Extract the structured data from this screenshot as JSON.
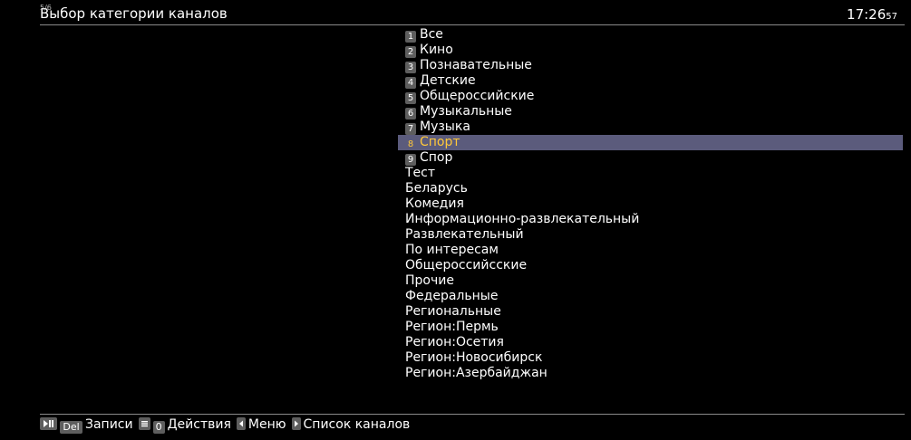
{
  "header": {
    "title": "Выбор категории каналов",
    "badge": "5/6",
    "clock_time": "17:26",
    "clock_seconds": "57"
  },
  "categories": [
    {
      "number": "1",
      "label": "Все"
    },
    {
      "number": "2",
      "label": "Кино"
    },
    {
      "number": "3",
      "label": "Познавательные"
    },
    {
      "number": "4",
      "label": "Детские"
    },
    {
      "number": "5",
      "label": "Общероссийские"
    },
    {
      "number": "6",
      "label": "Музыкальные"
    },
    {
      "number": "7",
      "label": "Музыка"
    },
    {
      "number": "8",
      "label": "Спорт",
      "selected": true
    },
    {
      "number": "9",
      "label": "Спор"
    },
    {
      "label": "Тест"
    },
    {
      "label": "Беларусь"
    },
    {
      "label": "Комедия"
    },
    {
      "label": "Информационно-развлекательный"
    },
    {
      "label": "Развлекательный"
    },
    {
      "label": "По интересам"
    },
    {
      "label": "Общероссийсские"
    },
    {
      "label": "Прочие"
    },
    {
      "label": "Федеральные"
    },
    {
      "label": "Региональные"
    },
    {
      "label": "Регион:Пермь"
    },
    {
      "label": "Регион:Осетия"
    },
    {
      "label": "Регион:Новосибирск"
    },
    {
      "label": "Регион:Азербайджан"
    }
  ],
  "footer": {
    "key_del": "Del",
    "records_label": "Записи",
    "key_zero": "0",
    "actions_label": "Действия",
    "menu_label": "Меню",
    "channels_label": "Список каналов",
    "icons": {
      "play_pause": "play-pause-icon",
      "menu": "menu-icon",
      "left": "arrow-left-icon",
      "right": "arrow-right-icon"
    }
  },
  "colors": {
    "background": "#000000",
    "text": "#ffffff",
    "selection_bg": "#5b5b7c",
    "selection_text": "#ffc83a",
    "key_bg": "#5e5e5e"
  }
}
